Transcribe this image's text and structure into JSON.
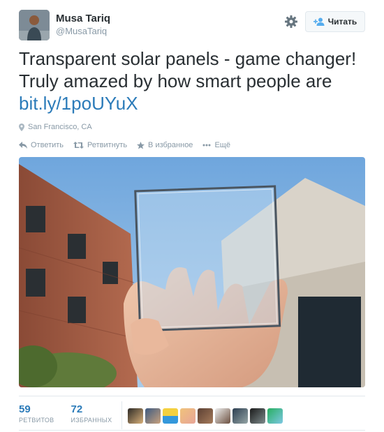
{
  "header": {
    "name": "Musa Tariq",
    "handle": "@MusaTariq",
    "follow_label": "Читать"
  },
  "icons": {
    "settings": "gear-icon",
    "follow": "person-plus-icon",
    "location": "map-pin-icon",
    "reply": "reply-icon",
    "retweet": "retweet-icon",
    "favorite": "star-icon",
    "more": "more-dots-icon"
  },
  "tweet": {
    "text": "Transparent solar panels - game changer! Truly amazed by how smart people are",
    "link": "bit.ly/1poUYuX",
    "location": "San Francisco, CA"
  },
  "actions": {
    "reply": "Ответить",
    "retweet": "Ретвитнуть",
    "favorite": "В избранное",
    "more": "Ещё"
  },
  "stats": {
    "retweets_count": "59",
    "retweets_label": "РЕТВИТОВ",
    "favorites_count": "72",
    "favorites_label": "ИЗБРАННЫХ"
  },
  "colors": {
    "link": "#2b7bb9",
    "muted": "#8899a6",
    "text": "#292f33",
    "border": "#e1e8ed"
  }
}
